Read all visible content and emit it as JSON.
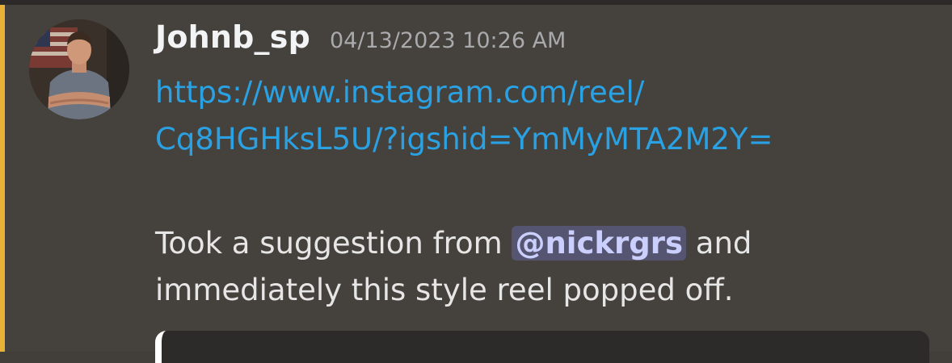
{
  "message": {
    "author": "Johnb_sp",
    "timestamp": "04/13/2023 10:26 AM",
    "link_line1": "https://www.instagram.com/reel/",
    "link_line2": "Cq8HGHksL5U/?igshid=YmMyMTA2M2Y=",
    "text_before_mention": "Took a suggestion from ",
    "mention": "@nickrgrs",
    "text_after_mention": " and",
    "text_line2": "immediately this style reel popped off."
  },
  "colors": {
    "background": "#45413c",
    "highlight": "#e8b13a",
    "link": "#2aa1e3",
    "mention_bg": "#565571",
    "mention_text": "#cbcffd"
  },
  "icons": {
    "avatar": "user-avatar"
  }
}
